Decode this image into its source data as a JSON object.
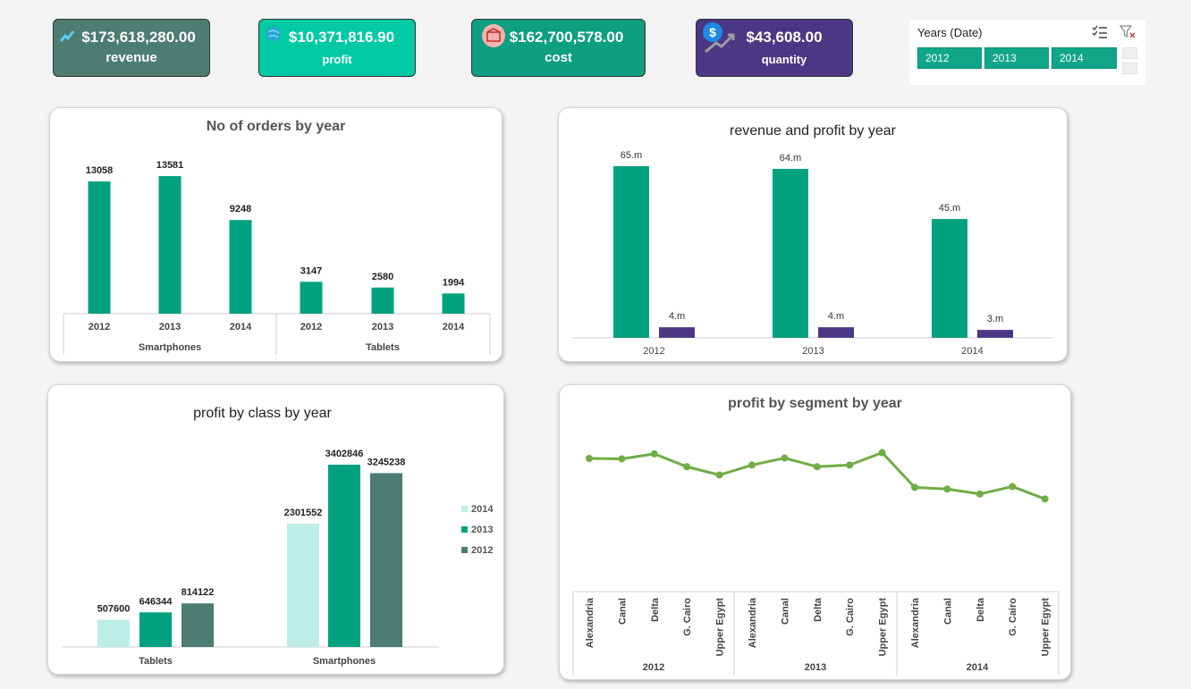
{
  "kpis": {
    "revenue": {
      "value": "$173,618,280.00",
      "label": "revenue",
      "color": "#4d7c70"
    },
    "profit": {
      "value": "$10,371,816.90",
      "label": "profit",
      "color": "#00c9a3"
    },
    "cost": {
      "value": "$162,700,578.00",
      "label": "cost",
      "color": "#0e9e80"
    },
    "quantity": {
      "value": "$43,608.00",
      "label": "quantity",
      "color": "#4a3884"
    }
  },
  "slicer": {
    "title": "Years (Date)",
    "items": [
      "2012",
      "2013",
      "2014"
    ],
    "selected_color": "#10a68a"
  },
  "colors": {
    "teal": "#00a17f",
    "dark_teal": "#4d7c70",
    "light_teal": "#bdeee5",
    "purple": "#4a3884",
    "green_line": "#70ad47"
  },
  "chart_data": [
    {
      "type": "bar",
      "title": "No of orders by year",
      "groups": [
        {
          "name": "Smartphones",
          "categories": [
            "2012",
            "2013",
            "2014"
          ],
          "values": [
            13058,
            13581,
            9248
          ]
        },
        {
          "name": "Tablets",
          "categories": [
            "2012",
            "2013",
            "2014"
          ],
          "values": [
            3147,
            2580,
            1994
          ]
        }
      ],
      "ylim": [
        0,
        15000
      ]
    },
    {
      "type": "bar",
      "title": "revenue and profit by year",
      "categories": [
        "2012",
        "2013",
        "2014"
      ],
      "series": [
        {
          "values": [
            65,
            64,
            45
          ],
          "labels": [
            "65.m",
            "64.m",
            "45.m"
          ]
        },
        {
          "values": [
            4,
            4,
            3
          ],
          "labels": [
            "4.m",
            "4.m",
            "3.m"
          ]
        }
      ],
      "ylim": [
        0,
        65
      ]
    },
    {
      "type": "bar",
      "title": "profit by class by year",
      "categories": [
        "Tablets",
        "Smartphones"
      ],
      "series": [
        {
          "name": "2014",
          "values": [
            507600,
            2301552
          ]
        },
        {
          "name": "2013",
          "values": [
            646344,
            3402846
          ]
        },
        {
          "name": "2012",
          "values": [
            814122,
            3245238
          ]
        }
      ],
      "legend_order": [
        "2014",
        "2013",
        "2012"
      ],
      "legend_placement": "right",
      "ylim": [
        0,
        3402846
      ]
    },
    {
      "type": "line",
      "title": "profit by segment by year",
      "groups": [
        "2012",
        "2013",
        "2014"
      ],
      "segments": [
        "Alexandria",
        "Canal",
        "Delta",
        "G. Cairo",
        "Upper Egypt"
      ],
      "values": [
        800000,
        795000,
        855000,
        700000,
        600000,
        720000,
        805000,
        700000,
        720000,
        870000,
        450000,
        430000,
        370000,
        460000,
        310000
      ],
      "ylim": [
        -800000,
        1200000
      ]
    }
  ]
}
